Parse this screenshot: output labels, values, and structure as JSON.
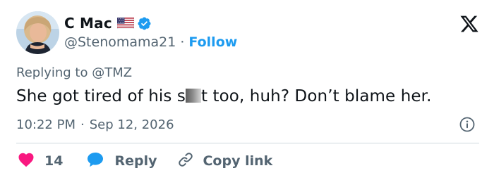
{
  "author": {
    "display_name": "C Mac",
    "handle": "@Stenomama21",
    "separator": "·",
    "follow_label": "Follow",
    "flag_icon": "us-flag-icon",
    "verified_icon": "verified-badge-icon",
    "verified_color": "#1d9bf0"
  },
  "brand": {
    "logo_icon": "x-logo-icon"
  },
  "tweet": {
    "replying_prefix": "Replying to ",
    "replying_to": "@TMZ",
    "text_before": "She got tired of his s",
    "text_after": "t too, huh?  Don’t blame her.",
    "time": "10:22 PM",
    "meta_separator": "·",
    "date": "Sep 12, 2026"
  },
  "actions": {
    "like_count": "14",
    "like_color": "#f91880",
    "reply_label": "Reply",
    "reply_color": "#1d9bf0",
    "copy_label": "Copy link"
  },
  "colors": {
    "text_primary": "#0f1419",
    "text_secondary": "#536471",
    "accent": "#1d9bf0",
    "divider": "#cfd9de"
  }
}
